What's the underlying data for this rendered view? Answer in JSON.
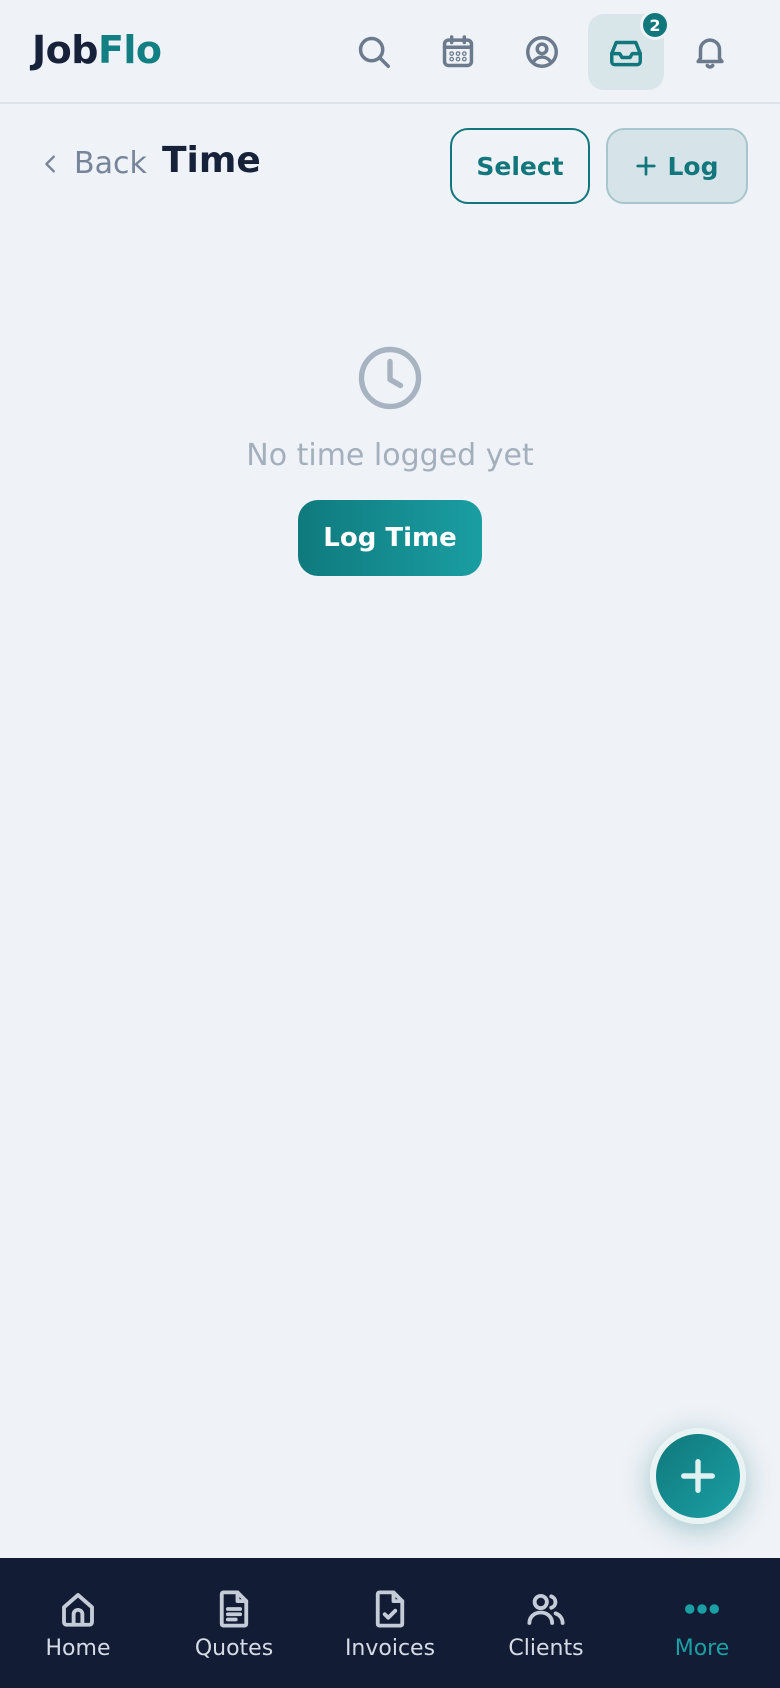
{
  "header": {
    "logo_part1": "Job",
    "logo_part2": "Flo",
    "icons": [
      "search-icon",
      "calendar-icon",
      "user-circle-icon",
      "inbox-icon",
      "bell-icon"
    ],
    "inbox_badge": "2"
  },
  "subheader": {
    "back_label": "Back",
    "title": "Time",
    "select_label": "Select",
    "log_label": "Log"
  },
  "empty_state": {
    "message": "No time logged yet",
    "button_label": "Log Time"
  },
  "bottom_nav": {
    "items": [
      {
        "label": "Home",
        "icon": "home-icon"
      },
      {
        "label": "Quotes",
        "icon": "document-icon"
      },
      {
        "label": "Invoices",
        "icon": "invoice-check-icon"
      },
      {
        "label": "Clients",
        "icon": "users-icon"
      },
      {
        "label": "More",
        "icon": "more-dots-icon"
      }
    ],
    "active_index": 4
  },
  "colors": {
    "accent": "#12777c",
    "background": "#eff2f7",
    "nav_background": "#121d35",
    "title_text": "#16213a"
  }
}
